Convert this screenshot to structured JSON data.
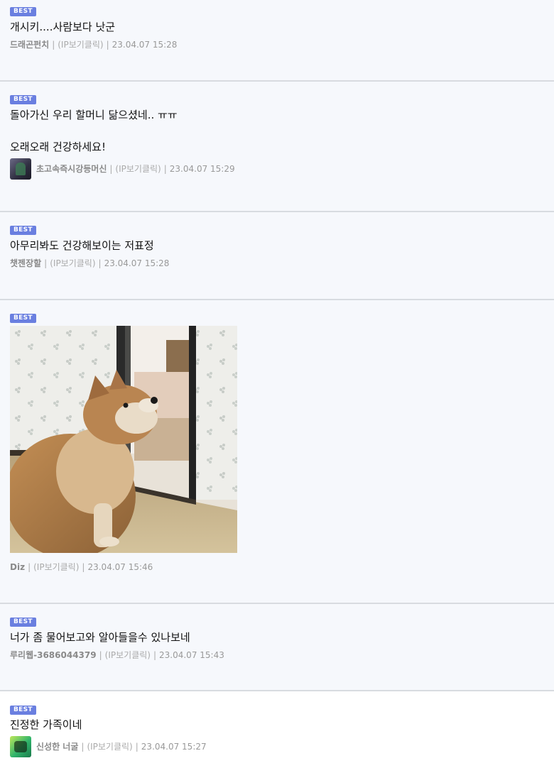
{
  "comments": [
    {
      "badge": "BEST",
      "text": "개시키....사람보다 낫군",
      "nick": "드래곤펀치",
      "ip": "(IP보기클릭)",
      "date": "23.04.07 15:28"
    },
    {
      "badge": "BEST",
      "text1": "돌아가신 우리 할머니 닮으셨네.. ㅠㅠ",
      "text2": "오래오래 건강하세요!",
      "nick": "초고속즉시강등머신",
      "ip": "(IP보기클릭)",
      "date": "23.04.07 15:29"
    },
    {
      "badge": "BEST",
      "text": "아무리봐도 건강해보이는 저표정",
      "nick": "챗젠장할",
      "ip": "(IP보기클릭)",
      "date": "23.04.07 15:28"
    },
    {
      "badge": "BEST",
      "nick": "Diz",
      "ip": "(IP보기클릭)",
      "date": "23.04.07 15:46"
    },
    {
      "badge": "BEST",
      "text": "너가 좀 물어보고와 알아들을수 있나보네",
      "nick": "루리웹-3686044379",
      "ip": "(IP보기클릭)",
      "date": "23.04.07 15:43"
    },
    {
      "badge": "BEST",
      "text": "진정한 가족이네",
      "nick": "신성한 너굴",
      "ip": "(IP보기클릭)",
      "date": "23.04.07 15:27"
    }
  ],
  "sep": "|"
}
